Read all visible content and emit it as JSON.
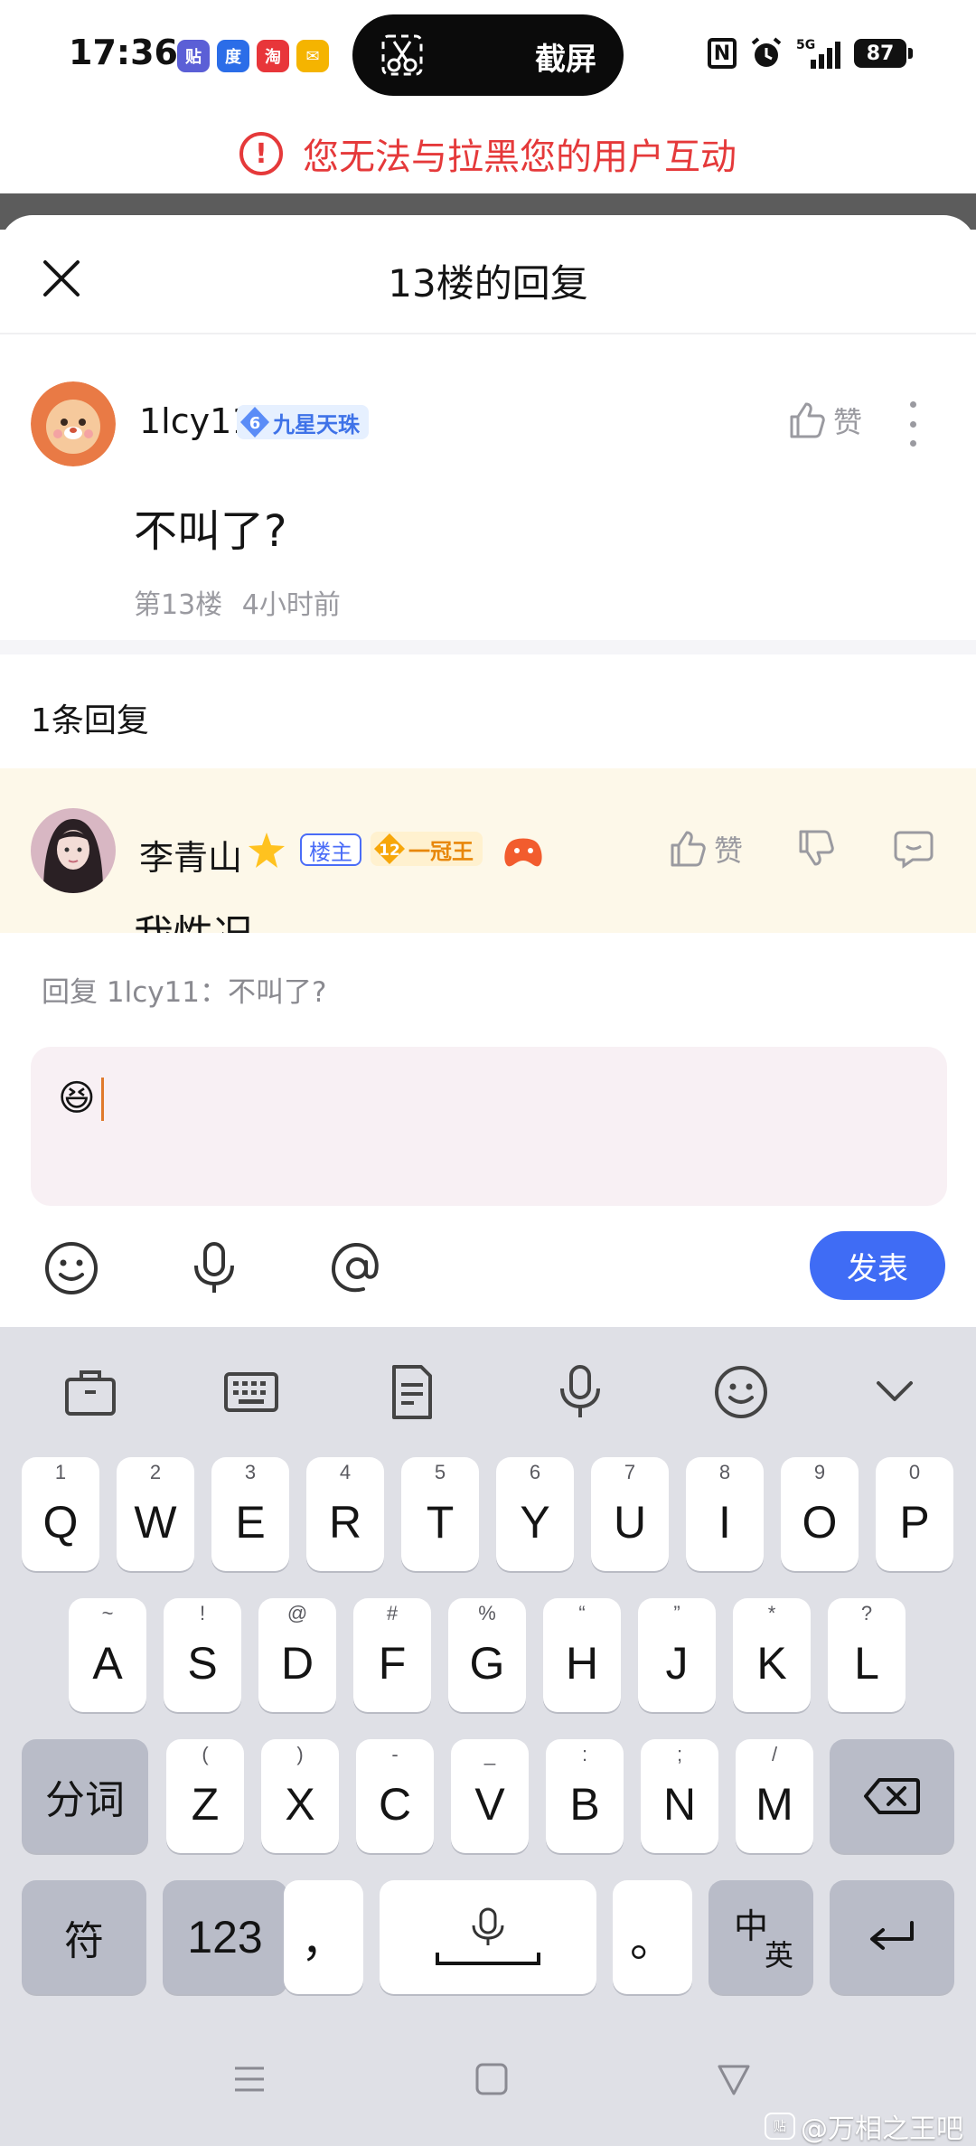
{
  "status_bar": {
    "time": "17:36",
    "notif_icons": [
      {
        "name": "tieba-icon",
        "label": "贴",
        "color": "#5b5fd6"
      },
      {
        "name": "baidu-icon",
        "label": "度",
        "color": "#2b6de8"
      },
      {
        "name": "taobao-icon",
        "label": "淘",
        "color": "#e8363a"
      },
      {
        "name": "mail-icon",
        "label": "✉",
        "color": "#f5b400"
      }
    ],
    "pill_label": "截屏",
    "network": "5G",
    "battery": "87"
  },
  "warning": {
    "text": "您无法与拉黑您的用户互动"
  },
  "sheet": {
    "title": "13楼的回复"
  },
  "main_post": {
    "username": "1lcy11",
    "level": "6",
    "level_title": "九星天珠",
    "like_label": "赞",
    "content": "不叫了?",
    "floor": "第13楼",
    "time": "4小时前"
  },
  "replies": {
    "count_label": "1条回复",
    "items": [
      {
        "username": "李青山",
        "host_tag": "楼主",
        "level": "12",
        "level_title": "一冠王",
        "like_label": "赞",
        "content_preview": "我性况"
      }
    ]
  },
  "compose": {
    "reply_to": "回复 1lcy11：不叫了?",
    "input_value": "😆",
    "send_label": "发表"
  },
  "keyboard": {
    "row1": [
      {
        "k": "Q",
        "h": "1"
      },
      {
        "k": "W",
        "h": "2"
      },
      {
        "k": "E",
        "h": "3"
      },
      {
        "k": "R",
        "h": "4"
      },
      {
        "k": "T",
        "h": "5"
      },
      {
        "k": "Y",
        "h": "6"
      },
      {
        "k": "U",
        "h": "7"
      },
      {
        "k": "I",
        "h": "8"
      },
      {
        "k": "O",
        "h": "9"
      },
      {
        "k": "P",
        "h": "0"
      }
    ],
    "row2": [
      {
        "k": "A",
        "h": "~"
      },
      {
        "k": "S",
        "h": "!"
      },
      {
        "k": "D",
        "h": "@"
      },
      {
        "k": "F",
        "h": "#"
      },
      {
        "k": "G",
        "h": "%"
      },
      {
        "k": "H",
        "h": "“"
      },
      {
        "k": "J",
        "h": "”"
      },
      {
        "k": "K",
        "h": "*"
      },
      {
        "k": "L",
        "h": "?"
      }
    ],
    "row3": [
      {
        "k": "Z",
        "h": "("
      },
      {
        "k": "X",
        "h": ")"
      },
      {
        "k": "C",
        "h": "-"
      },
      {
        "k": "V",
        "h": "_"
      },
      {
        "k": "B",
        "h": ":"
      },
      {
        "k": "N",
        "h": ";"
      },
      {
        "k": "M",
        "h": "/"
      }
    ],
    "segment_label": "分词",
    "symbol_label": "符",
    "number_label": "123",
    "comma_label": "，",
    "period_label": "。",
    "lang_cn": "中",
    "lang_en": "英"
  },
  "watermark": {
    "logo": "贴",
    "text": "@万相之王吧"
  }
}
